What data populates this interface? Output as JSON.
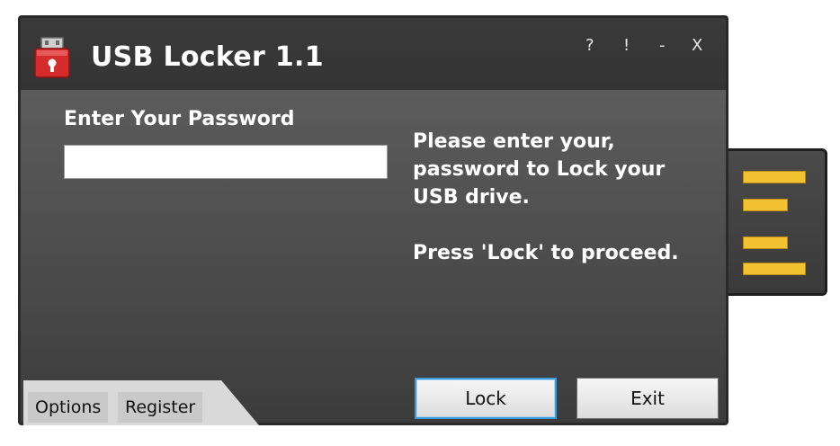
{
  "window": {
    "title": "USB Locker 1.1",
    "controls": {
      "help": "?",
      "about": "!",
      "minimize": "-",
      "close": "X"
    }
  },
  "form": {
    "password_label": "Enter Your Password",
    "password_value": "",
    "password_placeholder": ""
  },
  "info": {
    "line1": "Please enter your,",
    "line2": "password to Lock your",
    "line3": "USB drive.",
    "line4": "Press 'Lock' to proceed."
  },
  "tabs": {
    "options": "Options",
    "register": "Register"
  },
  "buttons": {
    "lock": "Lock",
    "exit": "Exit"
  },
  "colors": {
    "window_bg": "#505050",
    "titlebar_bg": "#363636",
    "text": "#ffffff",
    "connector_pins": "#f2c230",
    "icon_red": "#d62b2b",
    "focus_border": "#3c9ad9"
  },
  "icons": {
    "app": "usb-lock-icon"
  }
}
